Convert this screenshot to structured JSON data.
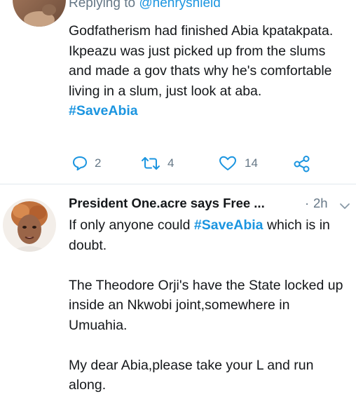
{
  "tweet1": {
    "reply_prefix": "Replying to",
    "reply_handle": "@henryshield",
    "text": "Godfatherism had finished Abia kpatakpata. Ikpeazu was just picked up from the slums and made a gov thats why he's comfortable living in a slum, just look at aba.",
    "hashtag": "#SaveAbia",
    "replies": "2",
    "retweets": "4",
    "likes": "14",
    "icons": [
      "reply-icon",
      "retweet-icon",
      "like-icon",
      "share-icon"
    ]
  },
  "tweet2": {
    "author": "President One.acre says Free ...",
    "dot": "·",
    "time": "2h",
    "text_before": "If only anyone could ",
    "hashtag": "#SaveAbia",
    "text_after": " which is in doubt.\n\nThe Theodore Orji's have the State locked up inside an Nkwobi joint,somewhere in Umuahia.\n\nMy dear Abia,please take your L and run along.",
    "icons": [
      "chevron-down-icon"
    ]
  },
  "colors": {
    "link": "#1b95e0",
    "muted": "#657786",
    "text": "#14171a",
    "divider": "#e1e8ed"
  }
}
